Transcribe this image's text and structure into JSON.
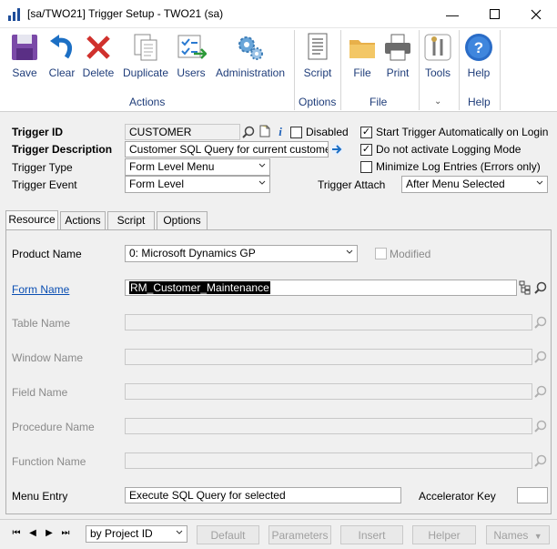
{
  "window": {
    "title": "[sa/TWO21] Trigger Setup  -  TWO21 (sa)"
  },
  "ribbon": {
    "save": "Save",
    "clear": "Clear",
    "delete": "Delete",
    "duplicate": "Duplicate",
    "users": "Users",
    "administration": "Administration",
    "script": "Script",
    "file": "File",
    "print": "Print",
    "tools": "Tools",
    "help": "Help",
    "group_actions": "Actions",
    "group_options": "Options",
    "group_file": "File",
    "group_help": "Help"
  },
  "form": {
    "trigger_id_label": "Trigger ID",
    "trigger_id_value": "CUSTOMER",
    "trigger_desc_label": "Trigger Description",
    "trigger_desc_value": "Customer SQL Query for current customer",
    "trigger_type_label": "Trigger Type",
    "trigger_type_value": "Form Level Menu",
    "trigger_event_label": "Trigger Event",
    "trigger_event_value": "Form Level",
    "disabled_label": "Disabled",
    "start_auto_label": "Start Trigger Automatically on Login",
    "no_logging_label": "Do not activate Logging Mode",
    "min_log_label": "Minimize Log Entries (Errors only)",
    "trigger_attach_label": "Trigger Attach",
    "trigger_attach_value": "After Menu Selected"
  },
  "tabs": [
    "Resource",
    "Actions",
    "Script",
    "Options"
  ],
  "resource": {
    "product_name_label": "Product Name",
    "product_name_value": "0: Microsoft Dynamics GP",
    "modified_label": "Modified",
    "form_name_label": "Form Name",
    "form_name_value": "RM_Customer_Maintenance",
    "table_name_label": "Table Name",
    "window_name_label": "Window Name",
    "field_name_label": "Field Name",
    "procedure_name_label": "Procedure Name",
    "function_name_label": "Function Name",
    "menu_entry_label": "Menu Entry",
    "menu_entry_value": "Execute SQL Query for selected",
    "accelerator_key_label": "Accelerator Key"
  },
  "bottom": {
    "sort_value": "by Project ID",
    "default": "Default",
    "parameters": "Parameters",
    "insert": "Insert",
    "helper": "Helper",
    "names": "Names"
  },
  "colors": {
    "ribbon_text": "#1f3d7a",
    "link": "#0b4fb3",
    "highlight": "#000000"
  }
}
